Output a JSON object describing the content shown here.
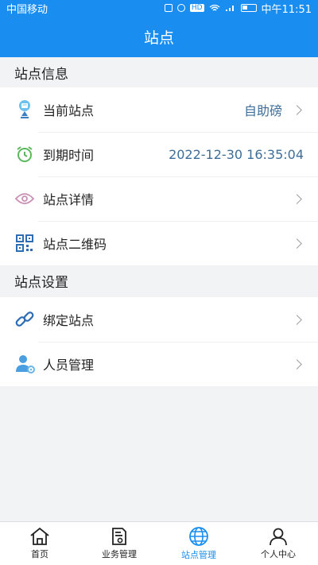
{
  "status": {
    "carrier": "中国移动",
    "time": "中午11:51",
    "hd": "HD"
  },
  "header": {
    "title": "站点"
  },
  "info_section": {
    "title": "站点信息",
    "items": [
      {
        "label": "当前站点",
        "value": "自助磅",
        "icon": "location-pin-icon"
      },
      {
        "label": "到期时间",
        "value": "2022-12-30 16:35:04",
        "icon": "alarm-clock-icon"
      },
      {
        "label": "站点详情",
        "value": "",
        "icon": "eye-icon"
      },
      {
        "label": "站点二维码",
        "value": "",
        "icon": "qr-code-icon"
      }
    ]
  },
  "settings_section": {
    "title": "站点设置",
    "items": [
      {
        "label": "绑定站点",
        "icon": "link-icon"
      },
      {
        "label": "人员管理",
        "icon": "user-gear-icon"
      }
    ]
  },
  "tabs": [
    {
      "label": "首页",
      "icon": "home-icon"
    },
    {
      "label": "业务管理",
      "icon": "document-gear-icon"
    },
    {
      "label": "站点管理",
      "icon": "globe-icon",
      "active": true
    },
    {
      "label": "个人中心",
      "icon": "person-icon"
    }
  ],
  "colors": {
    "brand": "#1a8ef0",
    "value_text": "#3d6e9a"
  }
}
